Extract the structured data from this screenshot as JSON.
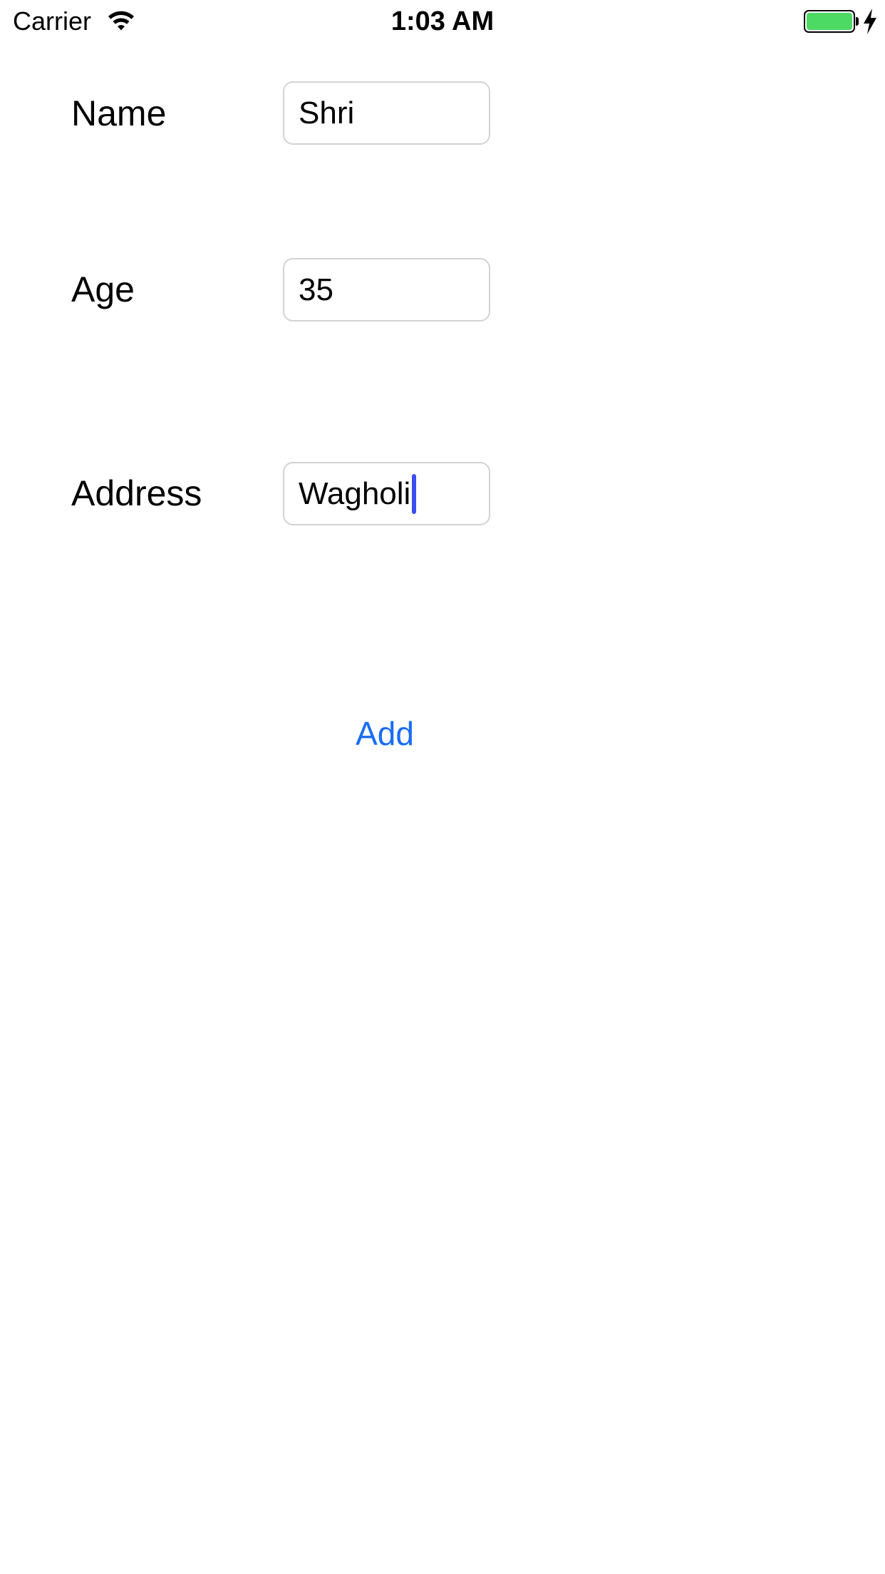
{
  "status_bar": {
    "carrier": "Carrier",
    "time": "1:03 AM",
    "wifi_icon": "wifi-icon",
    "battery_icon": "battery-icon",
    "charging_icon": "charging-bolt-icon",
    "battery_level": 1.0,
    "battery_color": "#4cd964"
  },
  "form": {
    "name": {
      "label": "Name",
      "value": "Shri"
    },
    "age": {
      "label": "Age",
      "value": "35"
    },
    "address": {
      "label": "Address",
      "value": "Wagholi",
      "focused": true
    }
  },
  "add_button": {
    "label": "Add"
  },
  "colors": {
    "accent": "#1a6cf5",
    "caret": "#3a4ef0",
    "field_border": "#d3d3d3",
    "background": "#ffffff"
  }
}
